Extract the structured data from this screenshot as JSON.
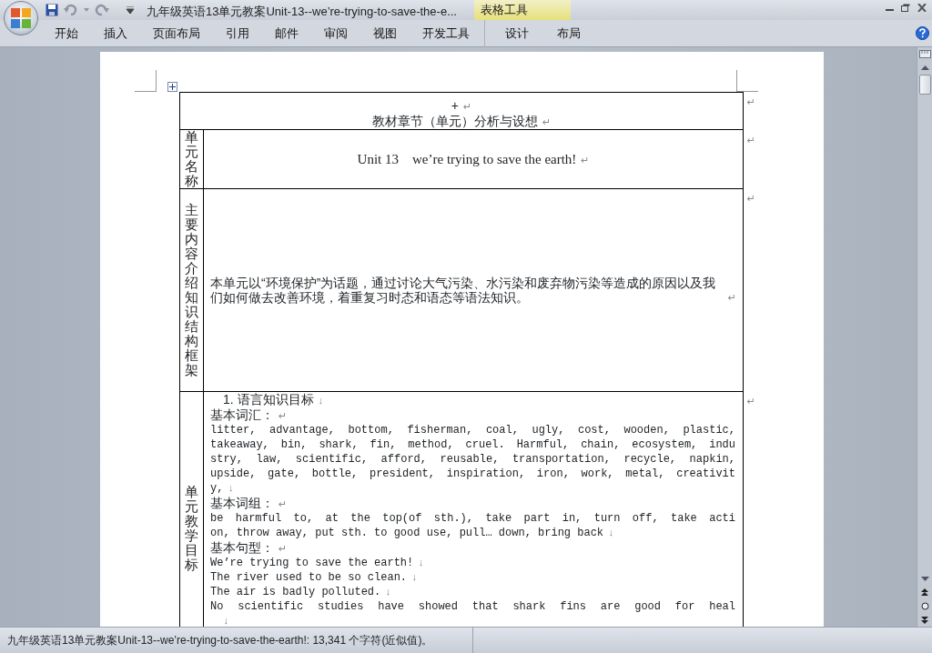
{
  "window": {
    "title": "九年级英语13单元教案Unit-13--we’re-trying-to-save-the-e...",
    "contextual_group": "表格工具"
  },
  "ribbon_tabs": [
    {
      "label": "开始",
      "selected": false
    },
    {
      "label": "插入",
      "selected": false
    },
    {
      "label": "页面布局",
      "selected": false
    },
    {
      "label": "引用",
      "selected": false
    },
    {
      "label": "邮件",
      "selected": false
    },
    {
      "label": "审阅",
      "selected": false
    },
    {
      "label": "视图",
      "selected": false
    },
    {
      "label": "开发工具",
      "selected": false
    },
    {
      "label": "设计",
      "selected": false,
      "contextual": true
    },
    {
      "label": "布局",
      "selected": false,
      "contextual": true
    }
  ],
  "table": {
    "rows": [
      {
        "kind": "title",
        "row_mark": "↵",
        "lines": [
          {
            "kind": "plain",
            "text": "+",
            "end_mark": "↵"
          },
          {
            "kind": "plain",
            "text": "教材章节（单元）分析与设想",
            "end_mark": "↵"
          }
        ]
      },
      {
        "kind": "name_row",
        "label": "单元名称",
        "row_mark": "↵",
        "lines": [
          {
            "kind": "serif",
            "text": "Unit 13    we’re trying to save the earth!",
            "end_mark": "↵"
          }
        ]
      },
      {
        "kind": "summary_row",
        "label": "主要内容介绍知识结构框架",
        "row_mark": "↵",
        "lines": [
          {
            "kind": "plain",
            "text": "本单元以“环境保护”为话题，通过讨论大气污染、水污染和废弃物污染等造成的原因以及我们如何做去改善环境，着重复习时态和语态等语法知识。",
            "end_mark": "↵"
          }
        ]
      },
      {
        "kind": "goals_row",
        "label": "单元教学目标",
        "row_mark": "↵",
        "lines": [
          {
            "kind": "heading",
            "text": "1. 语言知识目标",
            "end_mark": "↓"
          },
          {
            "kind": "plain",
            "text": "基本词汇：",
            "end_mark": "↵"
          },
          {
            "kind": "full",
            "text": "litter, advantage, bottom, fisherman, coal, ugly, cost, wooden, plastic,"
          },
          {
            "kind": "full",
            "text": "takeaway, bin, shark, fin, method, cruel. Harmful, chain, ecosystem, indu"
          },
          {
            "kind": "full",
            "text": "stry, law, scientific, afford, reusable, transportation, recycle, napkin,"
          },
          {
            "kind": "full",
            "text": "upside, gate, bottle, president, inspiration, iron, work, metal, creativit"
          },
          {
            "kind": "short",
            "text": "y,",
            "end_mark": "↓"
          },
          {
            "kind": "plain",
            "text": "基本词组：",
            "end_mark": "↵"
          },
          {
            "kind": "full",
            "text": "be harmful to, at the top(of sth.), take part in, turn off, take acti"
          },
          {
            "kind": "short",
            "text": "on, throw away, put sth. to good use, pull… down, bring back",
            "end_mark": "↓"
          },
          {
            "kind": "plain",
            "text": "基本句型：",
            "end_mark": "↵"
          },
          {
            "kind": "short",
            "text": "We’re trying to save the earth!",
            "end_mark": "↓"
          },
          {
            "kind": "short",
            "text": "The river used to be so clean.",
            "end_mark": "↓"
          },
          {
            "kind": "short",
            "text": "The air is badly polluted.",
            "end_mark": "↓"
          },
          {
            "kind": "full",
            "text": "No scientific studies have showed that shark fins are good for heal"
          },
          {
            "kind": "mark_only",
            "end_mark": "↓"
          }
        ]
      }
    ]
  },
  "status_bar": {
    "text": "九年级英语13单元教案Unit-13--we’re-trying-to-save-the-earth!: 13,341 个字符(近似值)。"
  }
}
